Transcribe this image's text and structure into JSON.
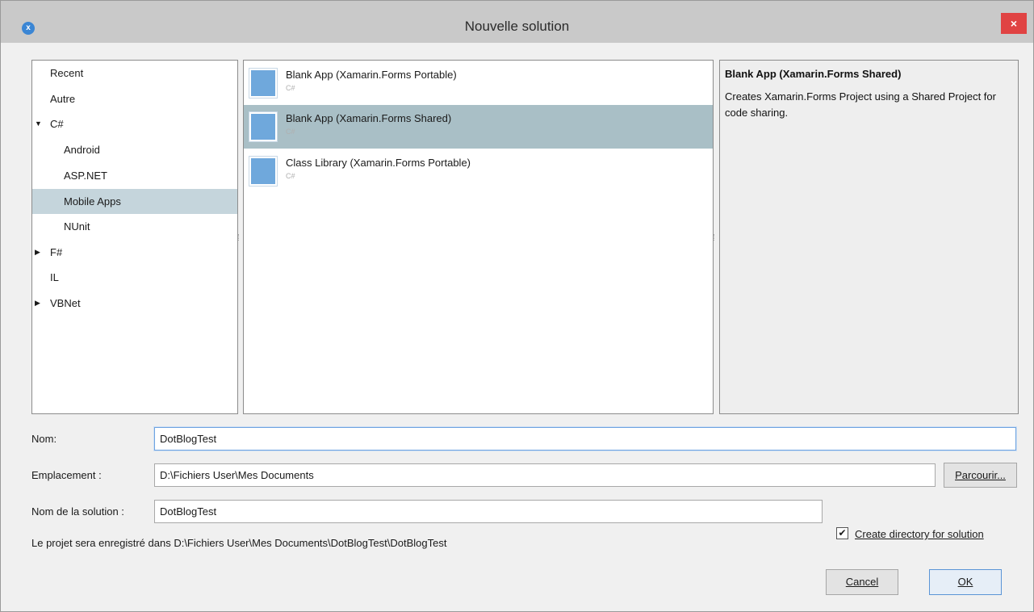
{
  "window": {
    "title": "Nouvelle solution",
    "close_glyph": "×",
    "app_glyph": "x"
  },
  "tree": {
    "items": [
      {
        "label": "Recent",
        "arrow": ""
      },
      {
        "label": "Autre",
        "arrow": ""
      },
      {
        "label": "C#",
        "arrow": "▼"
      },
      {
        "label": "Android",
        "arrow": ""
      },
      {
        "label": "ASP.NET",
        "arrow": ""
      },
      {
        "label": "Mobile Apps",
        "arrow": "",
        "selected": true
      },
      {
        "label": "NUnit",
        "arrow": ""
      },
      {
        "label": "F#",
        "arrow": "▶"
      },
      {
        "label": "IL",
        "arrow": ""
      },
      {
        "label": "VBNet",
        "arrow": "▶"
      }
    ]
  },
  "templates": {
    "items": [
      {
        "name": "Blank App (Xamarin.Forms Portable)",
        "lang": "C#"
      },
      {
        "name": "Blank App (Xamarin.Forms Shared)",
        "lang": "C#",
        "selected": true
      },
      {
        "name": "Class Library (Xamarin.Forms Portable)",
        "lang": "C#"
      }
    ]
  },
  "description": {
    "title": "Blank App (Xamarin.Forms Shared)",
    "body": "Creates Xamarin.Forms Project using a Shared Project for code sharing."
  },
  "form": {
    "name_label": "Nom:",
    "name_value": "DotBlogTest",
    "location_label": "Emplacement :",
    "location_value": "D:\\Fichiers User\\Mes Documents",
    "browse_label": "Parcourir...",
    "solution_label": "Nom de la solution :",
    "solution_value": "DotBlogTest",
    "create_dir_label": "Create directory for solution",
    "create_dir_checked": true,
    "save_path_text": "Le projet sera enregistré dans D:\\Fichiers User\\Mes Documents\\DotBlogTest\\DotBlogTest"
  },
  "buttons": {
    "cancel_label": "Cancel",
    "ok_label": "OK"
  },
  "colors": {
    "tree_selected": "#c5d5dc",
    "template_selected": "#a9bfc6",
    "close_red": "#e04343",
    "template_icon_blue": "#6fa8dc"
  }
}
